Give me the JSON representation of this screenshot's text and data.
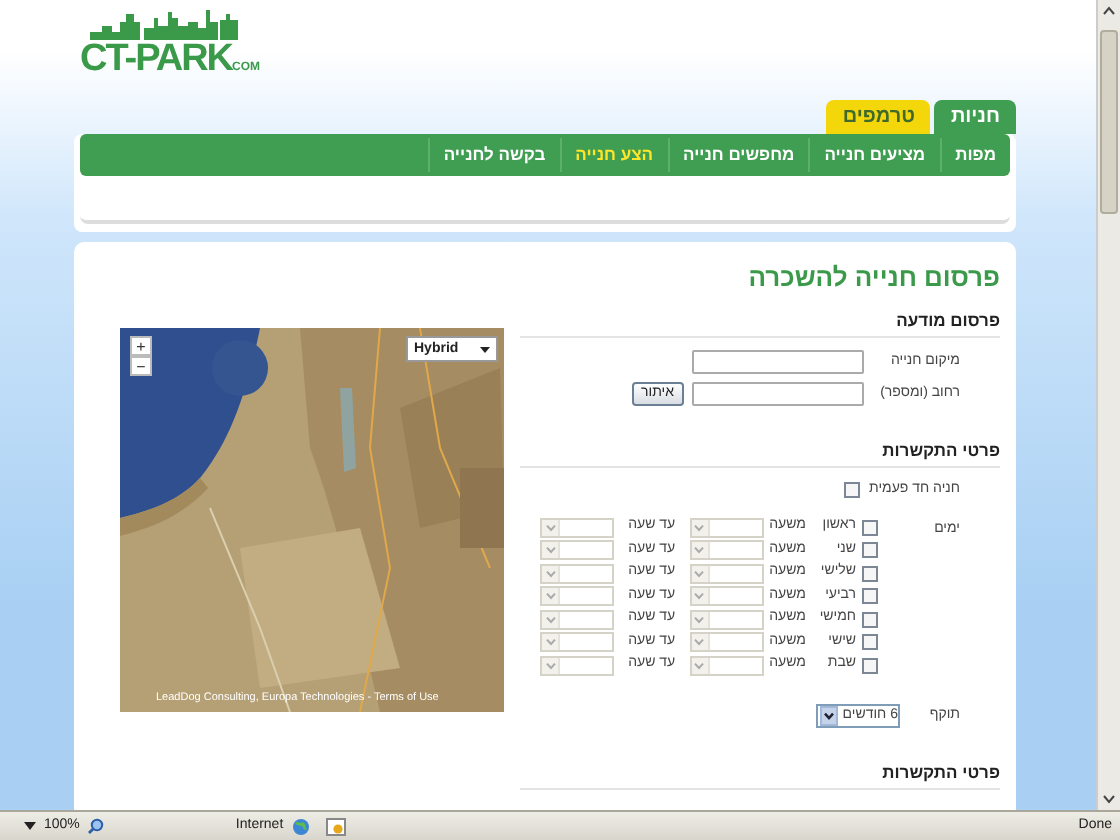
{
  "logo": {
    "main": "CT-PARK",
    "suffix": "COM"
  },
  "tabs": [
    {
      "label": "חניות",
      "selected": true
    },
    {
      "label": "טרמפים",
      "selected": false
    }
  ],
  "nav": [
    {
      "label": "מפות",
      "selected": false
    },
    {
      "label": "מציעים חנייה",
      "selected": false
    },
    {
      "label": "מחפשים חנייה",
      "selected": false
    },
    {
      "label": "הצע חנייה",
      "selected": true
    },
    {
      "label": "בקשה לחנייה",
      "selected": false
    }
  ],
  "page_title": "פרסום חנייה להשכרה",
  "ad_section": {
    "heading": "פרסום מודעה",
    "fields": [
      {
        "label": "מיקום חנייה"
      },
      {
        "label": "רחוב (ומספר)",
        "button": "איתור"
      }
    ]
  },
  "map": {
    "zoom_in": "+",
    "zoom_out": "−",
    "map_type": "Hybrid",
    "attribution": "LeadDog Consulting, Europa Technologies - Terms of Use"
  },
  "contact_section": {
    "heading": "פרטי התקשרות",
    "one_time": {
      "label": "חניה חד פעמית",
      "checked": false
    },
    "days_label": "ימים",
    "days": [
      {
        "name": "ראשון",
        "checked": false,
        "from_label": "משעה",
        "to_label": "עד שעה"
      },
      {
        "name": "שני",
        "checked": false,
        "from_label": "משעה",
        "to_label": "עד שעה"
      },
      {
        "name": "שלישי",
        "checked": false,
        "from_label": "משעה",
        "to_label": "עד שעה"
      },
      {
        "name": "רביעי",
        "checked": false,
        "from_label": "משעה",
        "to_label": "עד שעה"
      },
      {
        "name": "חמישי",
        "checked": false,
        "from_label": "משעה",
        "to_label": "עד שעה"
      },
      {
        "name": "שישי",
        "checked": false,
        "from_label": "משעה",
        "to_label": "עד שעה"
      },
      {
        "name": "שבת",
        "checked": false,
        "from_label": "משעה",
        "to_label": "עד שעה"
      }
    ],
    "validity": {
      "label": "תוקף",
      "value": "6 חודשים"
    }
  },
  "contact_section_2": {
    "heading": "פרטי התקשרות"
  },
  "status_bar": {
    "zoom": "100%",
    "zone": "Internet",
    "status": "Done"
  }
}
